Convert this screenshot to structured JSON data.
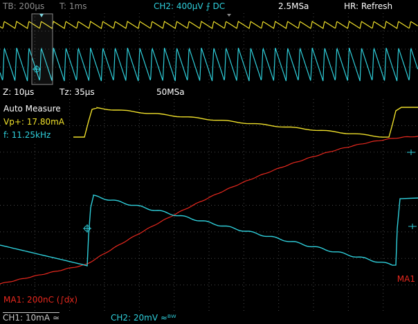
{
  "top_bar": {
    "timebase": "TB: 200µs",
    "trigger_time": "T: 1ms",
    "channel_setting": "CH2: 400µV ⨍ DC",
    "sample_rate": "2.5MSa",
    "acquire_mode": "HR: Refresh"
  },
  "zoom_bar": {
    "zoom_scale": "Z: 10µs",
    "zoom_position": "Tz: 35µs",
    "zoom_sample_rate": "50MSa"
  },
  "auto_measure": {
    "title": "Auto Measure",
    "items": [
      {
        "label": "Vp+: 17.80mA",
        "color": "#f0e02a"
      },
      {
        "label": "f: 11.25kHz",
        "color": "#2fd0dc"
      }
    ]
  },
  "math": {
    "label": "MA1: 200nC (∫dx)",
    "marker": "MA1"
  },
  "bottom_bar": {
    "ch1": "CH1: 10mA ≃",
    "ch2": "CH2: 20mV ≈ᴮᵂ"
  },
  "colors": {
    "ch1_trace": "#f0e02a",
    "ch2_trace": "#2fd0dc",
    "math_trace": "#e8281e",
    "grid": "#555555",
    "background": "#000000"
  }
}
